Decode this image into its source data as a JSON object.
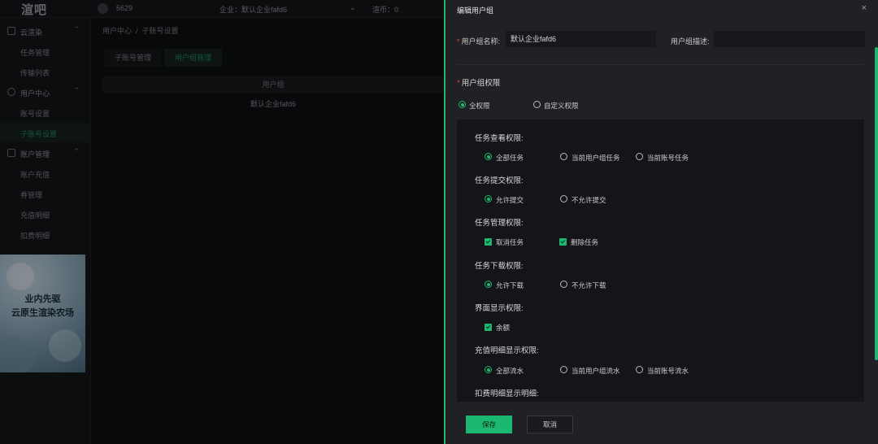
{
  "app": {
    "logo": "渲吧",
    "user_id": "5629",
    "company": "企业：默认企业fafd6",
    "balance": "渲币：0"
  },
  "sidebar": {
    "groups": [
      {
        "label": "云渲染",
        "items": [
          "任务管理",
          "传输列表"
        ]
      },
      {
        "label": "用户中心",
        "items": [
          "账号设置",
          "子账号设置"
        ]
      },
      {
        "label": "账户管理",
        "items": [
          "账户充值",
          "券管理",
          "充值明细",
          "扣费明细"
        ]
      }
    ],
    "active_item": "子账号设置"
  },
  "banner": {
    "line1": "业内先驱",
    "line2": "云原生渲染农场"
  },
  "content": {
    "breadcrumb": [
      "用户中心",
      "子账号设置"
    ],
    "tabs": [
      "子账号管理",
      "用户组管理"
    ],
    "active_tab": "用户组管理",
    "table": {
      "header": "用户组",
      "rows": [
        "默认企业fafd6"
      ]
    }
  },
  "drawer": {
    "title": "编辑用户组",
    "close": "×",
    "name_label": "用户组名称:",
    "name_value": "默认企业fafd6",
    "desc_label": "用户组描述:",
    "desc_value": "",
    "perm_label": "用户组权限",
    "perm_modes": [
      "全权限",
      "自定义权限"
    ],
    "perm_mode_selected": "全权限",
    "sections": [
      {
        "title": "任务查看权限:",
        "type": "radio",
        "options": [
          "全部任务",
          "当前用户组任务",
          "当前账号任务"
        ],
        "selected": "全部任务"
      },
      {
        "title": "任务提交权限:",
        "type": "radio",
        "options": [
          "允许提交",
          "不允许提交"
        ],
        "selected": "允许提交"
      },
      {
        "title": "任务管理权限:",
        "type": "checkbox",
        "options": [
          "取消任务",
          "删除任务"
        ],
        "checked": [
          "取消任务",
          "删除任务"
        ]
      },
      {
        "title": "任务下载权限:",
        "type": "radio",
        "options": [
          "允许下载",
          "不允许下载"
        ],
        "selected": "允许下载"
      },
      {
        "title": "界面显示权限:",
        "type": "checkbox",
        "options": [
          "余额"
        ],
        "checked": [
          "余额"
        ]
      },
      {
        "title": "充值明细显示权限:",
        "type": "radio",
        "options": [
          "全部流水",
          "当前用户组流水",
          "当前账号流水"
        ],
        "selected": "全部流水"
      },
      {
        "title": "扣费明细显示明细:",
        "type": "radio",
        "options": [],
        "selected": ""
      }
    ],
    "save_label": "保存",
    "cancel_label": "取消"
  },
  "colors": {
    "accent": "#1db870",
    "required": "#e0453a",
    "panel": "#141518",
    "drawer": "#202124"
  }
}
